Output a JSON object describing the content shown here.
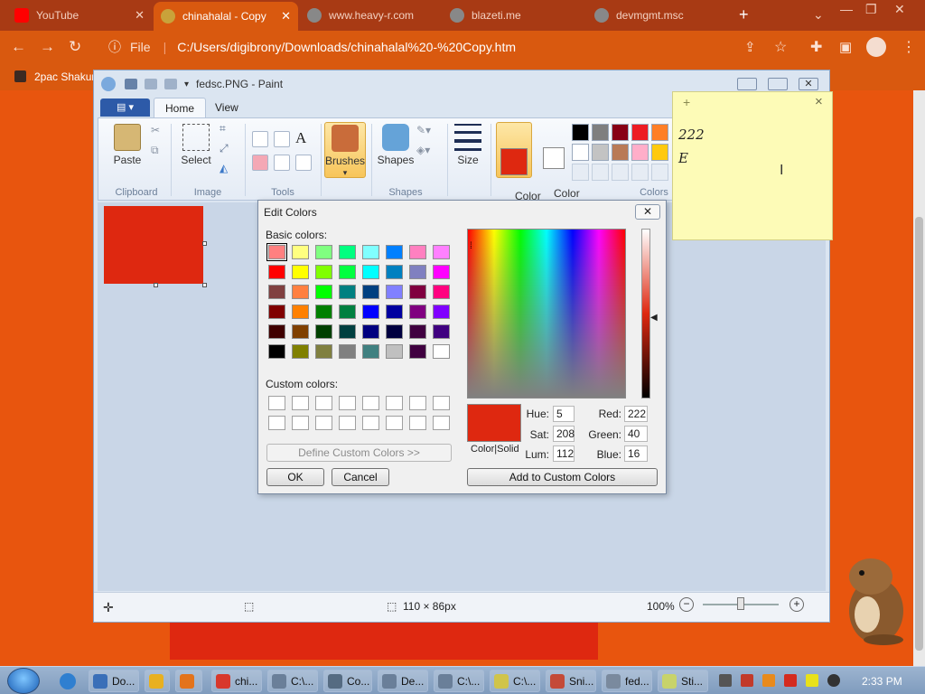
{
  "browser": {
    "tabs": [
      {
        "label": "YouTube",
        "active": false
      },
      {
        "label": "chinahalal - Copy",
        "active": true
      },
      {
        "label": "www.heavy-r.com",
        "active": false
      },
      {
        "label": "blazeti.me",
        "active": false
      },
      {
        "label": "devmgmt.msc",
        "active": false
      }
    ],
    "new_tab": "+",
    "address": {
      "scheme_label": "File",
      "url": "C:/Users/digibrony/Downloads/chinahalal%20-%20Copy.htm"
    },
    "bookmark": "2pac Shakur"
  },
  "paint": {
    "title": "fedsc.PNG - Paint",
    "tabs": [
      "Home",
      "View"
    ],
    "groups": [
      "Clipboard",
      "Image",
      "Tools",
      "Shapes",
      "Colors"
    ],
    "buttons": {
      "paste": "Paste",
      "select": "Select",
      "brushes": "Brushes",
      "shapes": "Shapes",
      "size": "Size",
      "color1": "Color\n1",
      "color2": "Color\n2"
    },
    "palette": [
      "#000000",
      "#7f7f7f",
      "#880015",
      "#ed1c24",
      "#ff7f27",
      "#ffffff",
      "#c3c3c3",
      "#b97a57",
      "#ffaec9",
      "#ffc90e"
    ],
    "status": {
      "dimensions": "110 × 86px",
      "zoom": "100%"
    },
    "image_color": "#de2810"
  },
  "dialog": {
    "title": "Edit Colors",
    "close": "✕",
    "basic_label": "Basic colors:",
    "custom_label": "Custom colors:",
    "define_btn": "Define Custom Colors >>",
    "ok": "OK",
    "cancel": "Cancel",
    "add_btn": "Add to Custom Colors",
    "colorsolid": "Color|Solid",
    "fields": {
      "hue": {
        "label": "Hue:",
        "value": "5"
      },
      "sat": {
        "label": "Sat:",
        "value": "208"
      },
      "lum": {
        "label": "Lum:",
        "value": "112"
      },
      "red": {
        "label": "Red:",
        "value": "222"
      },
      "green": {
        "label": "Green:",
        "value": "40"
      },
      "blue": {
        "label": "Blue:",
        "value": "16"
      }
    },
    "basic_colors": [
      "#ff8080",
      "#ffff80",
      "#80ff80",
      "#00ff80",
      "#80ffff",
      "#0080ff",
      "#ff80c0",
      "#ff80ff",
      "#ff0000",
      "#ffff00",
      "#80ff00",
      "#00ff40",
      "#00ffff",
      "#0080c0",
      "#8080c0",
      "#ff00ff",
      "#804040",
      "#ff8040",
      "#00ff00",
      "#008080",
      "#004080",
      "#8080ff",
      "#800040",
      "#ff0080",
      "#800000",
      "#ff8000",
      "#008000",
      "#008040",
      "#0000ff",
      "#0000a0",
      "#800080",
      "#8000ff",
      "#400000",
      "#804000",
      "#004000",
      "#004040",
      "#000080",
      "#000040",
      "#400040",
      "#400080",
      "#000000",
      "#808000",
      "#808040",
      "#808080",
      "#408080",
      "#c0c0c0",
      "#400040",
      "#ffffff"
    ]
  },
  "sticky": {
    "lines": [
      "222",
      "E"
    ],
    "add": "+",
    "close": "×"
  },
  "taskbar": {
    "items": [
      "Do...",
      "",
      "",
      "chi...",
      "C:\\...",
      "Co...",
      "De...",
      "C:\\...",
      "C:\\...",
      "Sni...",
      "fed...",
      "Sti..."
    ],
    "time": "2:33 PM"
  }
}
